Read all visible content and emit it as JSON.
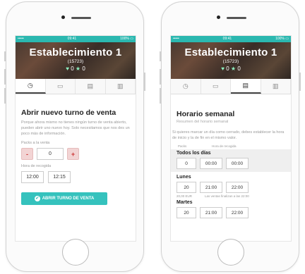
{
  "left": {
    "status": {
      "carrier": "•••••",
      "time": "09:41",
      "battery": "100% ▭"
    },
    "header": {
      "title": "Establecimiento 1",
      "code": "(15723)",
      "likes": "0",
      "rating": "0"
    },
    "tabs": [
      "clock-icon",
      "calendar-icon",
      "clipboard-icon",
      "chart-icon"
    ],
    "section_title": "Abrir nuevo turno de venta",
    "description": "Porque ahora mismo no tienes ningún turno de venta abierto, pueden abrir uno nuevo hoy. Solo necesitamos que nos des un poco más de información.",
    "pax_label": "Packs a la venta",
    "minus": "-",
    "pax_value": "0",
    "plus": "+",
    "pickup_label": "Hora de recogida",
    "pickup_start": "12:00",
    "pickup_end": "12:15",
    "cta": "ABRIR TURNO DE VENTA",
    "cta_icon": "✔"
  },
  "right": {
    "status": {
      "carrier": "•••••",
      "time": "09:41",
      "battery": "100% ▭"
    },
    "header": {
      "title": "Establecimiento 1",
      "code": "(15723)",
      "likes": "0",
      "rating": "0"
    },
    "tabs": [
      "clock-icon",
      "calendar-icon",
      "clipboard-icon",
      "chart-icon"
    ],
    "section_title": "Horario semanal",
    "subtitle": "Resumen del horario semanal",
    "description": "Si quieres marcar un día como cerrado, debes establecer la hora de inicio y la de fin en el mismo valor.",
    "col_packs": "Packs",
    "col_hours": "Hora de recogida",
    "days": [
      {
        "name": "Todos los días",
        "packs": "0",
        "start": "00:00",
        "end": "00:00"
      },
      {
        "name": "Lunes",
        "packs": "20",
        "start": "21:00",
        "end": "22:00",
        "price": "20,00 EUR",
        "note": "Las ventas finalizan a las 22:00"
      },
      {
        "name": "Martes",
        "packs": "20",
        "start": "21:00",
        "end": "22:00"
      }
    ]
  },
  "colors": {
    "accent": "#35c2bd",
    "status_bar": "#2bb8b0",
    "minus_bg": "#f2d4d4"
  }
}
